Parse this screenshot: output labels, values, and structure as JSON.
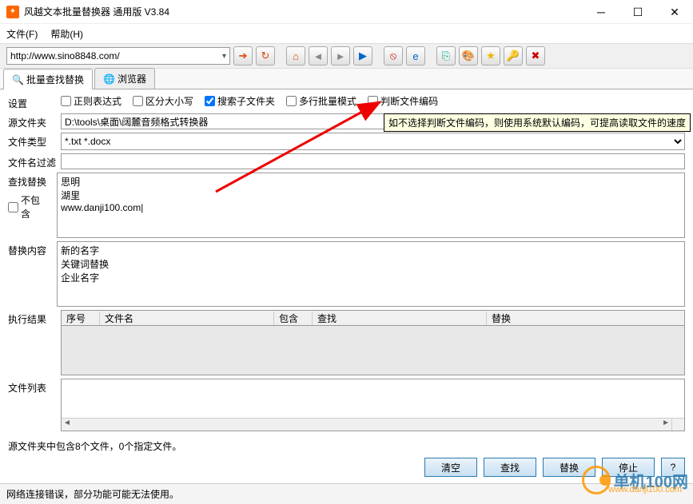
{
  "window": {
    "title": "风越文本批量替换器 通用版 V3.84"
  },
  "menu": {
    "file": "文件(F)",
    "help": "帮助(H)"
  },
  "url": {
    "value": "http://www.sino8848.com/"
  },
  "tabs": {
    "batch": "批量查找替换",
    "browser": "浏览器"
  },
  "settings": {
    "label": "设置",
    "regex": "正则表达式",
    "case": "区分大小写",
    "subfolder": "搜索子文件夹",
    "multiline": "多行批量模式",
    "encoding": "判断文件编码"
  },
  "tooltip_encoding": "如不选择判断文件编码，则使用系统默认编码，可提高读取文件的速度",
  "srcdir": {
    "label": "源文件夹",
    "value": "D:\\tools\\桌面\\阔麓音频格式转换器"
  },
  "filetype": {
    "label": "文件类型",
    "value": "*.txt *.docx"
  },
  "filter": {
    "label": "文件名过滤",
    "value": ""
  },
  "search": {
    "label": "查找替换",
    "exclude": "不包含",
    "value": "思明\n湖里\nwww.danji100.com|"
  },
  "replace": {
    "label": "替换内容",
    "value": "新的名字\n关键词替换\n企业名字"
  },
  "result": {
    "label": "执行结果",
    "cols": {
      "no": "序号",
      "name": "文件名",
      "contain": "包含",
      "find": "查找",
      "rep": "替换"
    }
  },
  "filelist": {
    "label": "文件列表"
  },
  "status1": "源文件夹中包含8个文件，0个指定文件。",
  "buttons": {
    "clear": "清空",
    "find": "查找",
    "replace": "替换",
    "stop": "停止",
    "help": "?"
  },
  "status2": "网络连接错误，部分功能可能无法使用。",
  "watermark": {
    "name": "单机100网",
    "url": "www.danji100.com"
  }
}
